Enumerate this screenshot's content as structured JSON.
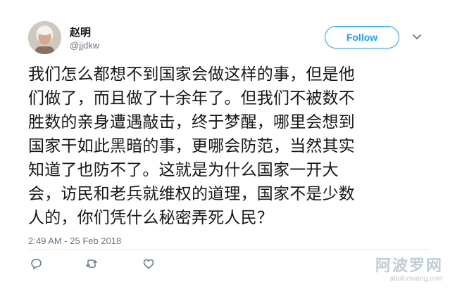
{
  "author": {
    "display_name": "赵明",
    "handle": "@jjdkw"
  },
  "follow_label": "Follow",
  "tweet": {
    "lines": [
      "我们怎么都想不到国家会做这样的事，但是他",
      "们做了，而且做了十余年了。但我们不被数不",
      "胜数的亲身遭遇敲击，终于梦醒，哪里会想到",
      "国家干如此黑暗的事，更哪会防范，当然其实",
      "知道了也防不了。这就是为什么国家一开大",
      "会，访民和老兵就维权的道理，国家不是少数",
      "人的，你们凭什么秘密弄死人民？"
    ],
    "timestamp": "2:49 AM - 25 Feb 2018"
  },
  "actions": {
    "reply_icon": "reply-icon",
    "retweet_icon": "retweet-icon",
    "like_icon": "heart-icon"
  },
  "watermark": {
    "main": "阿波罗网",
    "sub": "aboluowang.com"
  },
  "colors": {
    "accent": "#1da1f2",
    "text": "#14171a",
    "muted": "#657786"
  }
}
